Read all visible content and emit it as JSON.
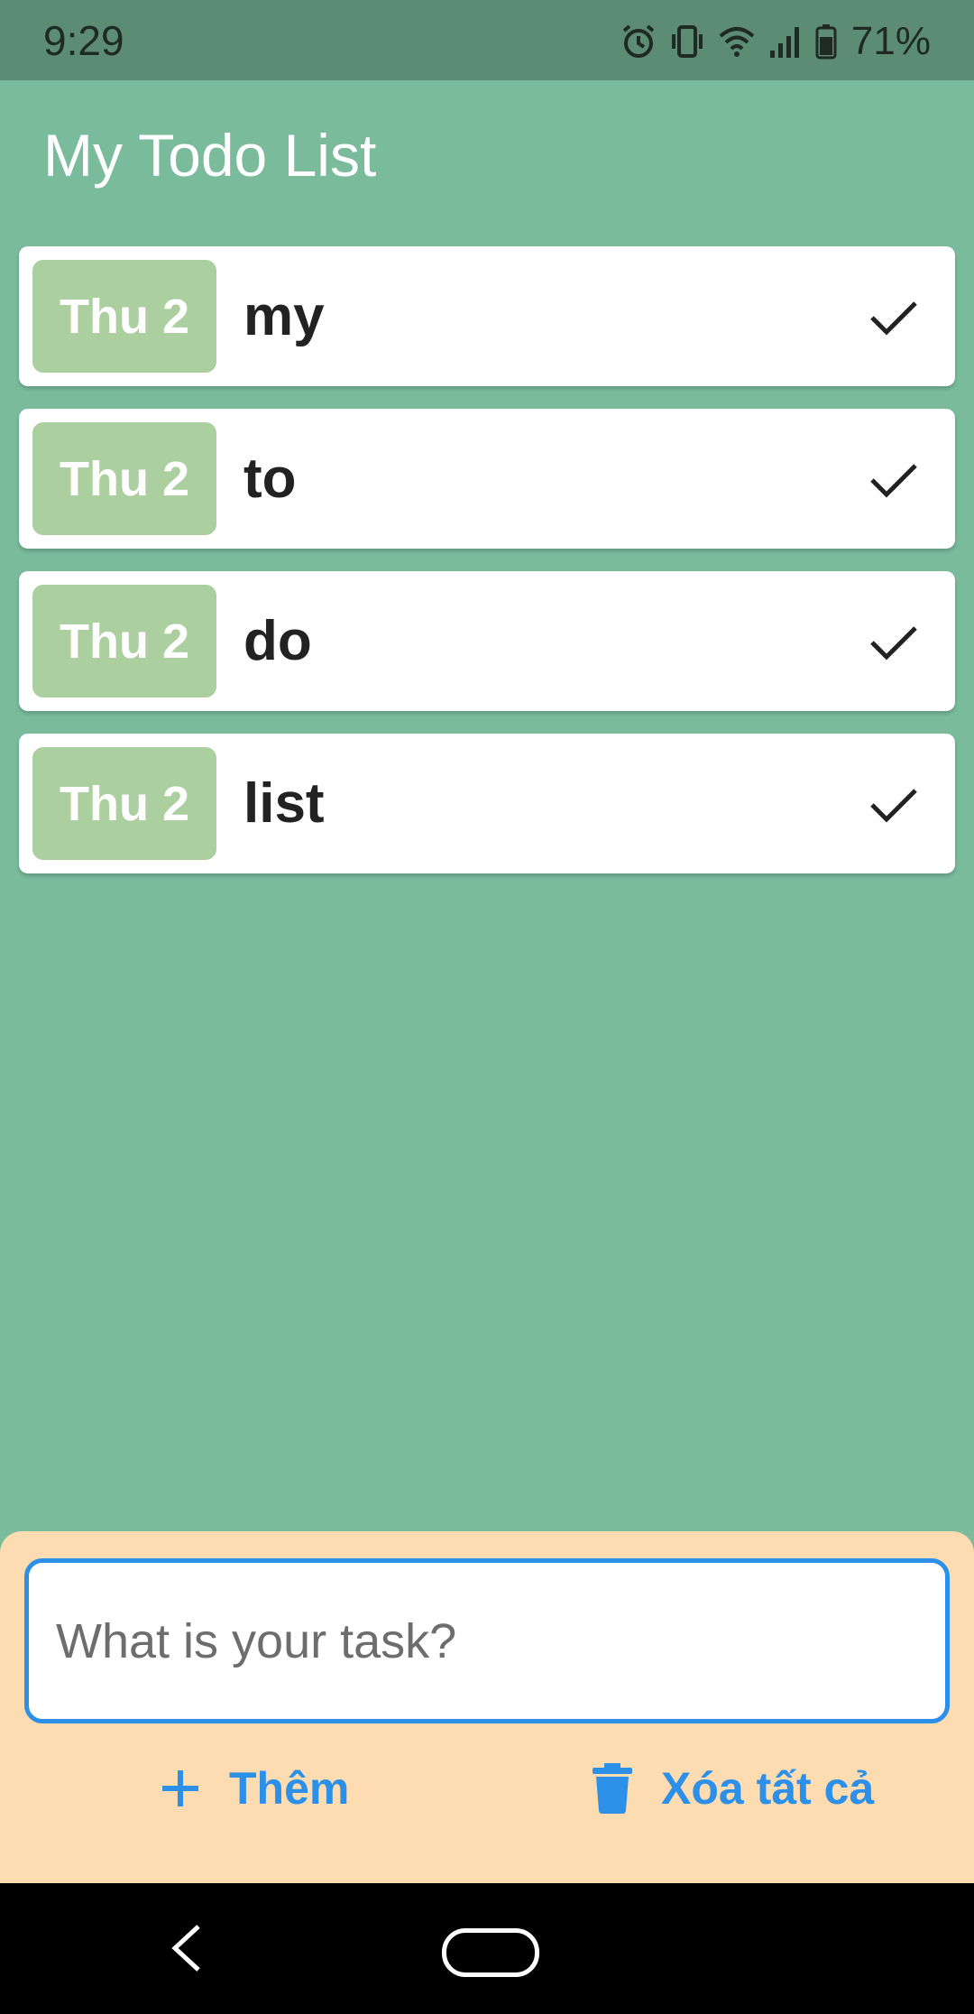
{
  "status_bar": {
    "time": "9:29",
    "battery": "71%",
    "icons": [
      "alarm-icon",
      "vibrate-icon",
      "wifi-icon",
      "signal-icon",
      "battery-icon"
    ]
  },
  "app": {
    "title": "My Todo List"
  },
  "todos": [
    {
      "date": "Thu 2",
      "text": "my"
    },
    {
      "date": "Thu 2",
      "text": "to"
    },
    {
      "date": "Thu 2",
      "text": "do"
    },
    {
      "date": "Thu 2",
      "text": "list"
    }
  ],
  "input": {
    "placeholder": "What is your task?",
    "value": ""
  },
  "actions": {
    "add_label": "Thêm",
    "clear_label": "Xóa tất cả"
  },
  "colors": {
    "background": "#79bb9b",
    "status_bar": "#5c8c75",
    "date_badge": "#abcf9f",
    "bottom_panel": "#fcdcb0",
    "accent": "#2c8fe8"
  }
}
